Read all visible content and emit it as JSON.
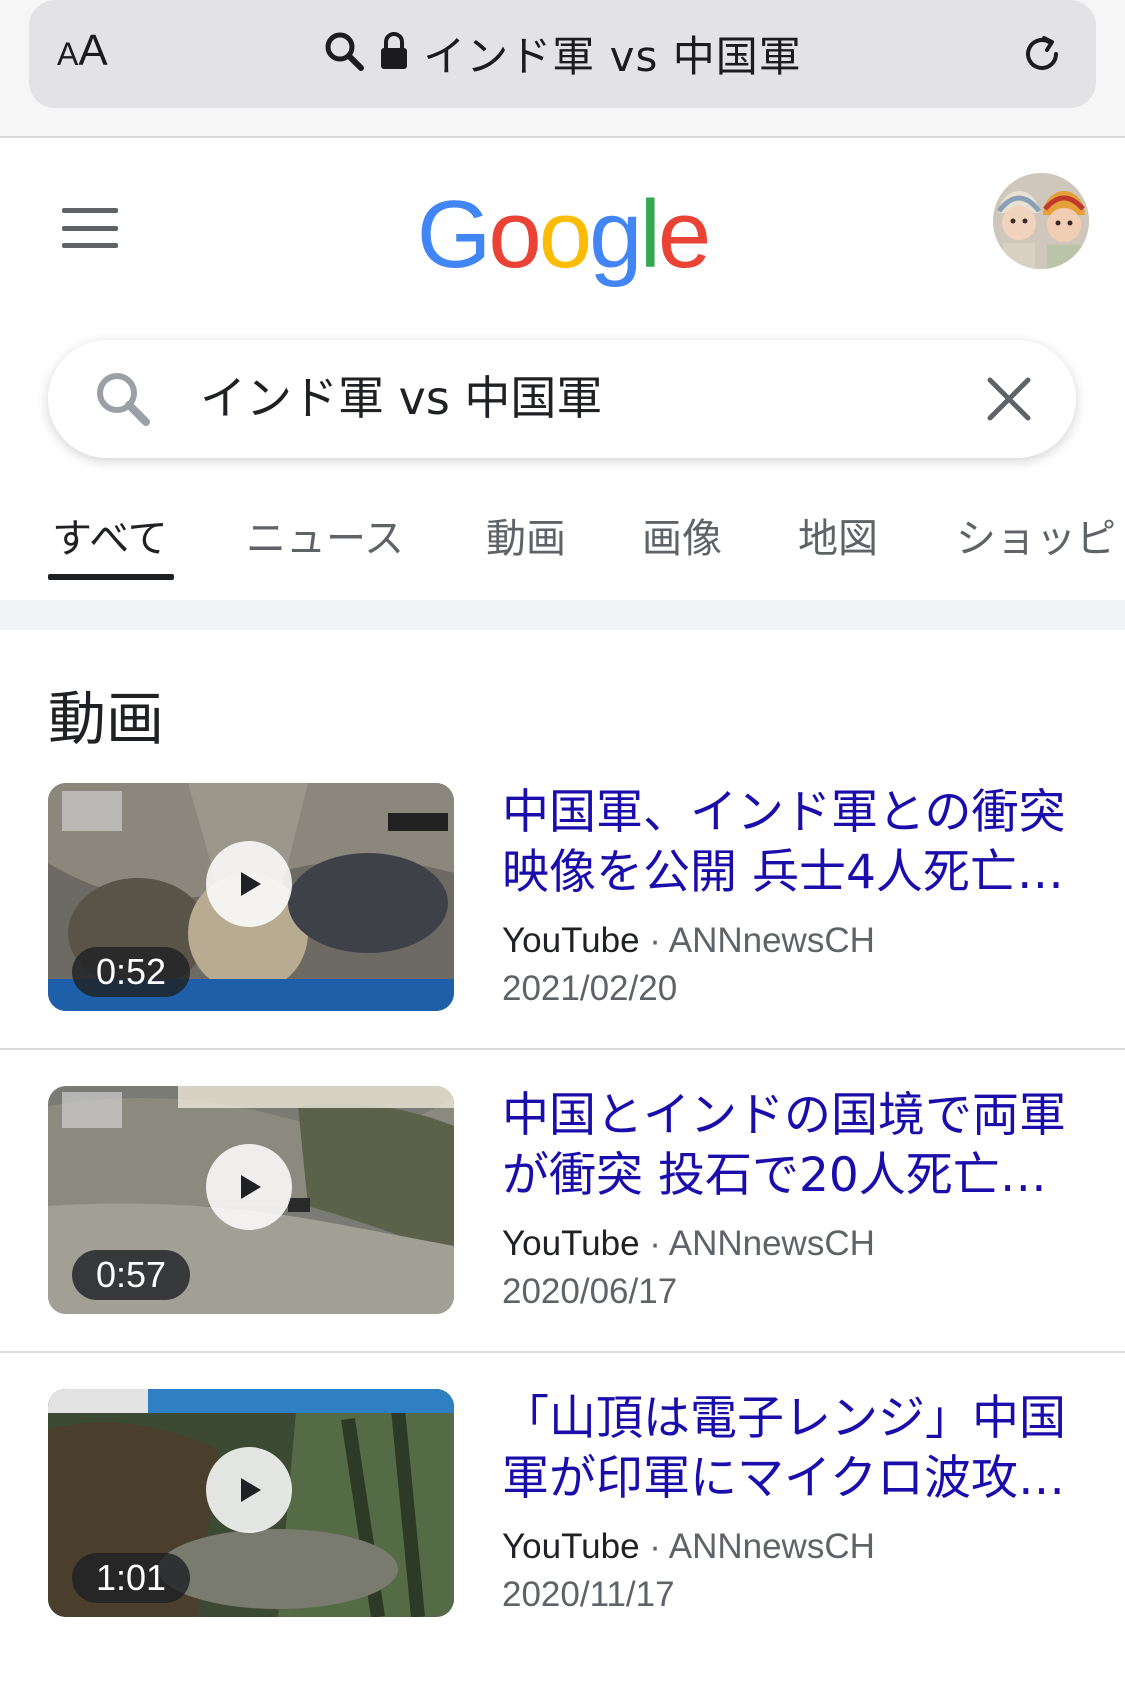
{
  "browser": {
    "text_size_small": "A",
    "text_size_big": "A",
    "url_text": "インド軍 vs 中国軍"
  },
  "colors": {
    "link": "#1a0dab",
    "logo_blue": "#4285f4",
    "logo_red": "#ea4335",
    "logo_yellow": "#fbbc05",
    "logo_green": "#34a853"
  },
  "header": {
    "logo_letters": [
      "G",
      "o",
      "o",
      "g",
      "l",
      "e"
    ],
    "menu_icon": "hamburger-icon",
    "avatar_icon": "account-avatar"
  },
  "search": {
    "query": "インド軍 vs 中国軍"
  },
  "tabs": [
    {
      "label": "すべて",
      "active": true
    },
    {
      "label": "ニュース",
      "active": false
    },
    {
      "label": "動画",
      "active": false
    },
    {
      "label": "画像",
      "active": false
    },
    {
      "label": "地図",
      "active": false
    },
    {
      "label": "ショッピ",
      "active": false
    }
  ],
  "section": {
    "title": "動画"
  },
  "videos": [
    {
      "title": "中国軍、インド軍との衝突映像を公開 兵士4人死亡…",
      "source": "YouTube",
      "separator": "·",
      "channel": "ANNnewsCH",
      "date": "2021/02/20",
      "duration": "0:52"
    },
    {
      "title": "中国とインドの国境で両軍が衝突 投石で20人死亡…",
      "source": "YouTube",
      "separator": "·",
      "channel": "ANNnewsCH",
      "date": "2020/06/17",
      "duration": "0:57"
    },
    {
      "title": "「山頂は電子レンジ」中国軍が印軍にマイクロ波攻…",
      "source": "YouTube",
      "separator": "·",
      "channel": "ANNnewsCH",
      "date": "2020/11/17",
      "duration": "1:01"
    }
  ]
}
